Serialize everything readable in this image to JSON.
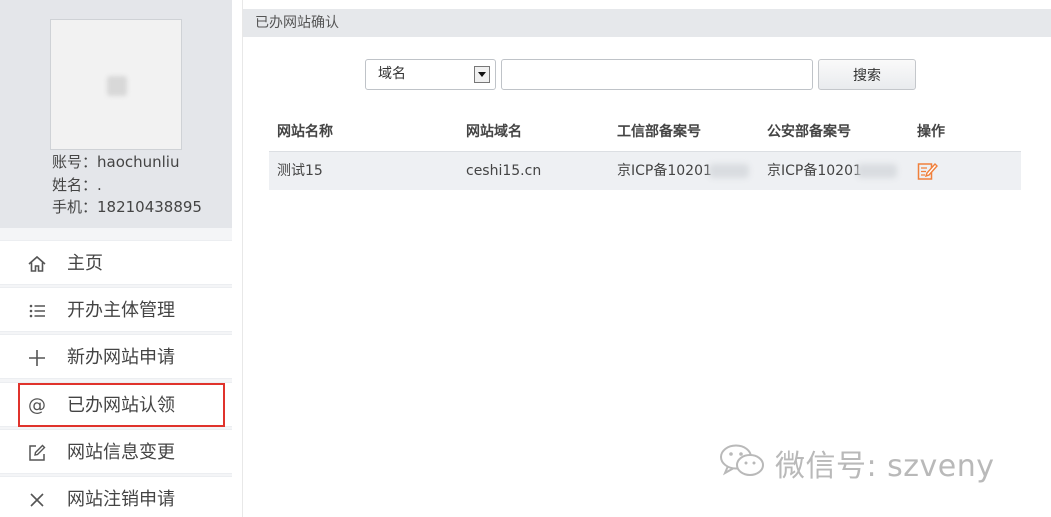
{
  "profile": {
    "account": "账号：haochunliu",
    "name": "姓名：.",
    "phone": "手机：18210438895"
  },
  "nav": [
    {
      "label": "主页",
      "icon": "home-icon"
    },
    {
      "label": "开办主体管理",
      "icon": "list-icon"
    },
    {
      "label": "新办网站申请",
      "icon": "plus-icon"
    },
    {
      "label": "已办网站认领",
      "icon": "at-icon",
      "active": true
    },
    {
      "label": "网站信息变更",
      "icon": "edit-icon"
    },
    {
      "label": "网站注销申请",
      "icon": "close-icon"
    }
  ],
  "main": {
    "title": "已办网站确认",
    "search": {
      "select_value": "域名",
      "input_value": "",
      "button_label": "搜索"
    },
    "table": {
      "columns": [
        "网站名称",
        "网站域名",
        "工信部备案号",
        "公安部备案号",
        "操作"
      ],
      "rows": [
        {
          "site_name": "测试15",
          "domain": "ceshi15.cn",
          "miit_no": "京ICP备10201",
          "mps_no": "京ICP备10201"
        }
      ]
    }
  },
  "watermark": "微信号: szveny",
  "colors": {
    "highlight_border": "#e0332c",
    "action_icon": "#f0803c",
    "sidebar_bg": "#e4e6ea"
  }
}
